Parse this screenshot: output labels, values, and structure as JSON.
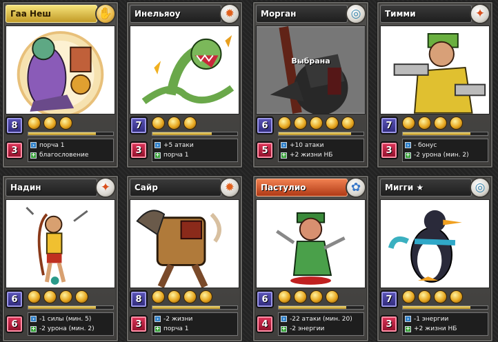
{
  "cards": [
    {
      "name": "Гаа Неш",
      "emblem": "gold-hand-icon",
      "style": "gold",
      "mana": "8",
      "hp": "3",
      "stars": 3,
      "xp": 0.8,
      "effects": [
        {
          "icon": "arrow",
          "text": "порча 1"
        },
        {
          "icon": "plus",
          "text": "благословение"
        }
      ],
      "selected": ""
    },
    {
      "name": "Инельяоу",
      "emblem": "fire-icon",
      "style": "normal",
      "mana": "7",
      "hp": "3",
      "stars": 3,
      "xp": 0.7,
      "effects": [
        {
          "icon": "arrow",
          "text": "+5 атаки"
        },
        {
          "icon": "plus",
          "text": "порча 1"
        }
      ],
      "selected": ""
    },
    {
      "name": "Морган",
      "emblem": "swirl-icon",
      "style": "normal",
      "mana": "6",
      "hp": "5",
      "stars": 5,
      "xp": 0.85,
      "effects": [
        {
          "icon": "arrow",
          "text": "+10 атаки"
        },
        {
          "icon": "plus",
          "text": "+2 жизни НБ"
        }
      ],
      "selected": "Выбрана"
    },
    {
      "name": "Тимми",
      "emblem": "paw-icon",
      "style": "normal",
      "mana": "7",
      "hp": "3",
      "stars": 4,
      "xp": 0.8,
      "effects": [
        {
          "icon": "arrow",
          "text": "- бонус"
        },
        {
          "icon": "plus",
          "text": "-2 урона (мин. 2)"
        }
      ],
      "selected": ""
    },
    {
      "name": "Надин",
      "emblem": "paw-icon",
      "style": "normal",
      "mana": "6",
      "hp": "6",
      "stars": 4,
      "xp": 0.8,
      "effects": [
        {
          "icon": "arrow",
          "text": "-1 силы (мин. 5)"
        },
        {
          "icon": "plus",
          "text": "-2 урона (мин. 2)"
        }
      ],
      "selected": ""
    },
    {
      "name": "Сайр",
      "emblem": "fire-icon",
      "style": "normal",
      "mana": "8",
      "hp": "3",
      "stars": 4,
      "xp": 0.8,
      "effects": [
        {
          "icon": "arrow",
          "text": "-2 жизни"
        },
        {
          "icon": "plus",
          "text": "порча 1"
        }
      ],
      "selected": ""
    },
    {
      "name": "Пастулио",
      "emblem": "bio-icon",
      "style": "orange",
      "mana": "6",
      "hp": "4",
      "stars": 4,
      "xp": 0.8,
      "effects": [
        {
          "icon": "arrow",
          "text": "-22 атаки (мин. 20)"
        },
        {
          "icon": "plus",
          "text": "-2 энергии"
        }
      ],
      "selected": ""
    },
    {
      "name": "Мигги ★",
      "emblem": "swirl-icon",
      "style": "normal",
      "mana": "7",
      "hp": "3",
      "stars": 4,
      "xp": 0.8,
      "effects": [
        {
          "icon": "arrow",
          "text": "-1 энергии"
        },
        {
          "icon": "plus",
          "text": "+2 жизни НБ"
        }
      ],
      "selected": ""
    }
  ]
}
